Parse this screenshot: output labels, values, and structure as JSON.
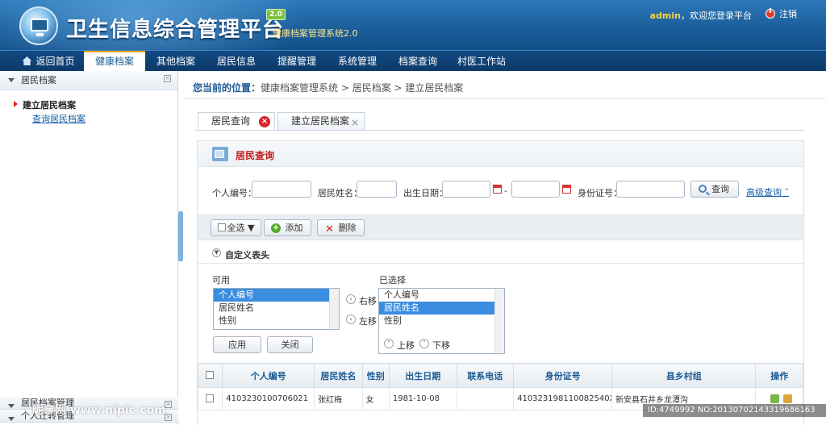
{
  "header": {
    "title": "卫生信息综合管理平台",
    "version": "2.0",
    "subtitle": "健康档案管理系统2.0",
    "user": "admin",
    "welcome": "，欢迎您登录平台",
    "logout": "注销"
  },
  "nav": {
    "items": [
      "返回首页",
      "健康档案",
      "其他档案",
      "居民信息",
      "提醒管理",
      "系统管理",
      "档案查询",
      "村医工作站"
    ],
    "active_index": 1
  },
  "sidebar": {
    "section": "居民档案",
    "items": [
      "建立居民档案",
      "查询居民档案"
    ],
    "bottom_sections": [
      "居民档案管理",
      "个人迁转管理"
    ]
  },
  "breadcrumb": {
    "label": "您当前的位置：",
    "path": "健康档案管理系统 > 居民档案 > 建立居民档案"
  },
  "tabs": [
    "居民查询",
    "建立居民档案"
  ],
  "panel": {
    "title": "居民查询",
    "fields": {
      "id_label": "个人编号：",
      "name_label": "居民姓名：",
      "dob_label": "出生日期：",
      "date_sep": "-",
      "card_label": "身份证号："
    },
    "search_button": "查询",
    "advanced": "高级查询",
    "toolbar": {
      "select_all": "全选",
      "add": "添加",
      "delete": "删除"
    },
    "custom_header": "自定义表头",
    "available_label": "可用",
    "available": [
      "个人编号",
      "居民姓名",
      "性别"
    ],
    "selected_label": "已选择",
    "selected": [
      "个人编号",
      "居民姓名",
      "性别"
    ],
    "move_right": "右移",
    "move_left": "左移",
    "move_up": "上移",
    "move_down": "下移",
    "apply": "应用",
    "close": "关闭"
  },
  "grid": {
    "columns": [
      "个人编号",
      "居民姓名",
      "性别",
      "出生日期",
      "联系电话",
      "身份证号",
      "县乡村组",
      "操作"
    ],
    "rows": [
      [
        "4103230100706021",
        "张红梅",
        "女",
        "1981-10-08",
        "",
        "410323198110082540X",
        "新安县石井乡龙潭沟"
      ]
    ]
  },
  "watermark": {
    "left": "昵享网 www.nipic.com",
    "right": "ID:4749992 NO:20130702143319686163"
  }
}
